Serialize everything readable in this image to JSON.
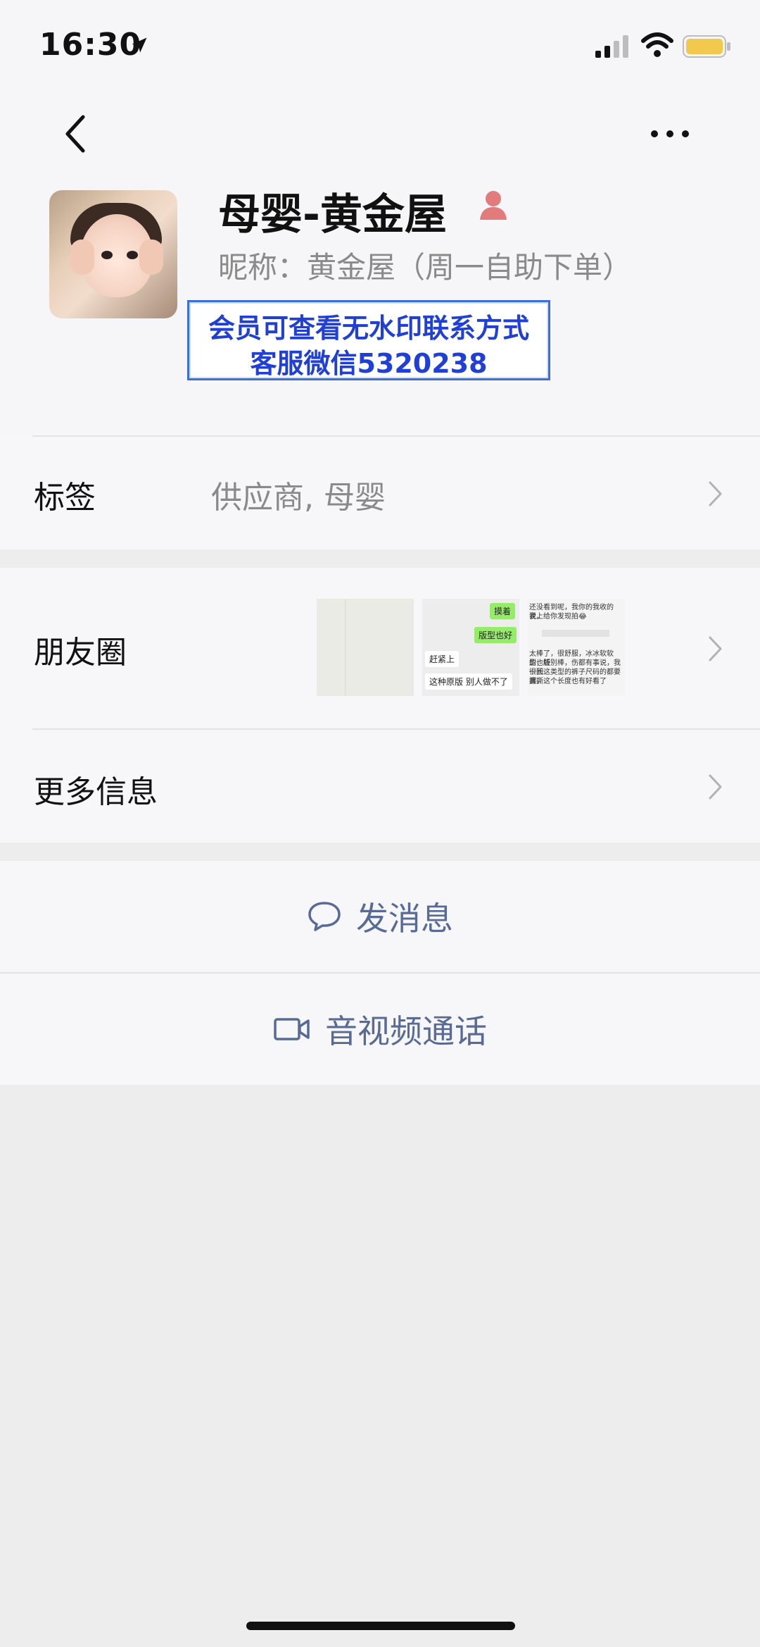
{
  "status_bar": {
    "time": "16:30",
    "battery_color": "#f2c94c"
  },
  "header": {
    "back_icon": "chevron-left-icon",
    "more_icon": "more-dots-icon"
  },
  "profile": {
    "name": "母婴-黄金屋",
    "nickname": "昵称：黄金屋（周一自助下单）",
    "gender_icon": "person-icon",
    "gender_color": "#e27b7b"
  },
  "watermark": {
    "line1": "会员可查看无水印联系方式",
    "line2": "客服微信5320238"
  },
  "rows": {
    "tags": {
      "label": "标签",
      "value": "供应商, 母婴"
    },
    "moments": {
      "label": "朋友圈",
      "thumb2": {
        "bubbles": [
          "摸着",
          "版型也好",
          "赶紧上",
          "这种原版 别人做不了"
        ]
      },
      "thumb3": {
        "texts": [
          "还没看到呢，我你的我收的说，",
          "我上给你发现拍😂",
          "太棒了，很舒服，冰冰软软的，版",
          "型也特别棒，伤都有事说，我很长",
          "一回这类型的裤子尺码的都要漏撕",
          "裤，这个长度也有好看了"
        ]
      }
    },
    "more_info": {
      "label": "更多信息"
    }
  },
  "actions": {
    "message": {
      "label": "发消息",
      "icon": "chat-bubble-icon"
    },
    "call": {
      "label": "音视频通话",
      "icon": "video-camera-icon"
    }
  },
  "colors": {
    "link": "#576b95",
    "watermark_text": "#1f3fd6",
    "watermark_border": "#3b6ed8"
  }
}
